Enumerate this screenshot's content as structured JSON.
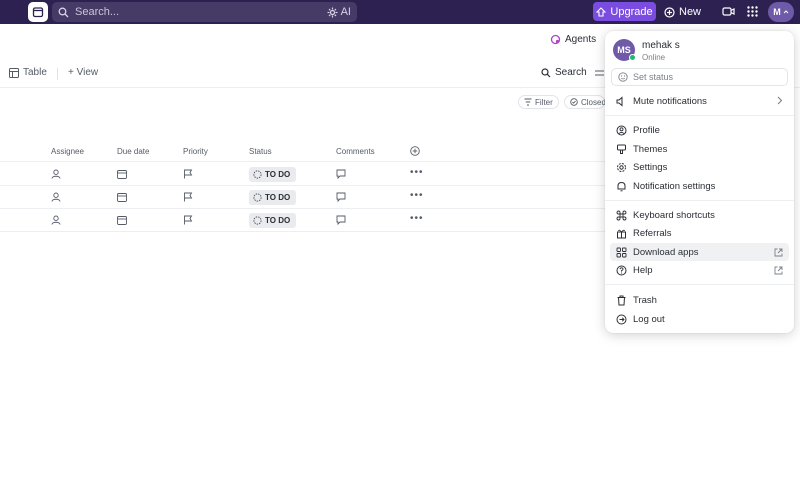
{
  "topbar": {
    "search_placeholder": "Search...",
    "ai_label": "AI",
    "upgrade_label": "Upgrade",
    "new_label": "New",
    "avatar_initial": "M"
  },
  "toolbar": {
    "agents_label": "Agents",
    "view_tab_label": "Table",
    "add_view_label": "+ View",
    "search_label": "Search",
    "filter_label": "Filter",
    "closed_label": "Closed"
  },
  "table": {
    "columns": [
      "Assignee",
      "Due date",
      "Priority",
      "Status",
      "Comments"
    ],
    "rows": [
      {
        "status": "TO DO"
      },
      {
        "status": "TO DO"
      },
      {
        "status": "TO DO"
      }
    ]
  },
  "menu": {
    "avatar_initials": "MS",
    "user_name": "mehak s",
    "presence": "Online",
    "set_status": "Set status",
    "items": [
      {
        "label": "Mute notifications",
        "icon": "mute-icon"
      },
      {
        "label": "Profile",
        "icon": "profile-icon"
      },
      {
        "label": "Themes",
        "icon": "themes-icon"
      },
      {
        "label": "Settings",
        "icon": "gear-icon"
      },
      {
        "label": "Notification settings",
        "icon": "bell-icon"
      },
      {
        "label": "Keyboard shortcuts",
        "icon": "command-icon"
      },
      {
        "label": "Referrals",
        "icon": "gift-icon"
      },
      {
        "label": "Download apps",
        "icon": "apps-icon"
      },
      {
        "label": "Help",
        "icon": "help-icon"
      },
      {
        "label": "Trash",
        "icon": "trash-icon"
      },
      {
        "label": "Log out",
        "icon": "logout-icon"
      }
    ]
  },
  "colors": {
    "topbar_bg": "#2c2150",
    "upgrade_bg": "#7b4ce0",
    "online_green": "#22b573",
    "avatar_purple": "#6e5aa8"
  }
}
